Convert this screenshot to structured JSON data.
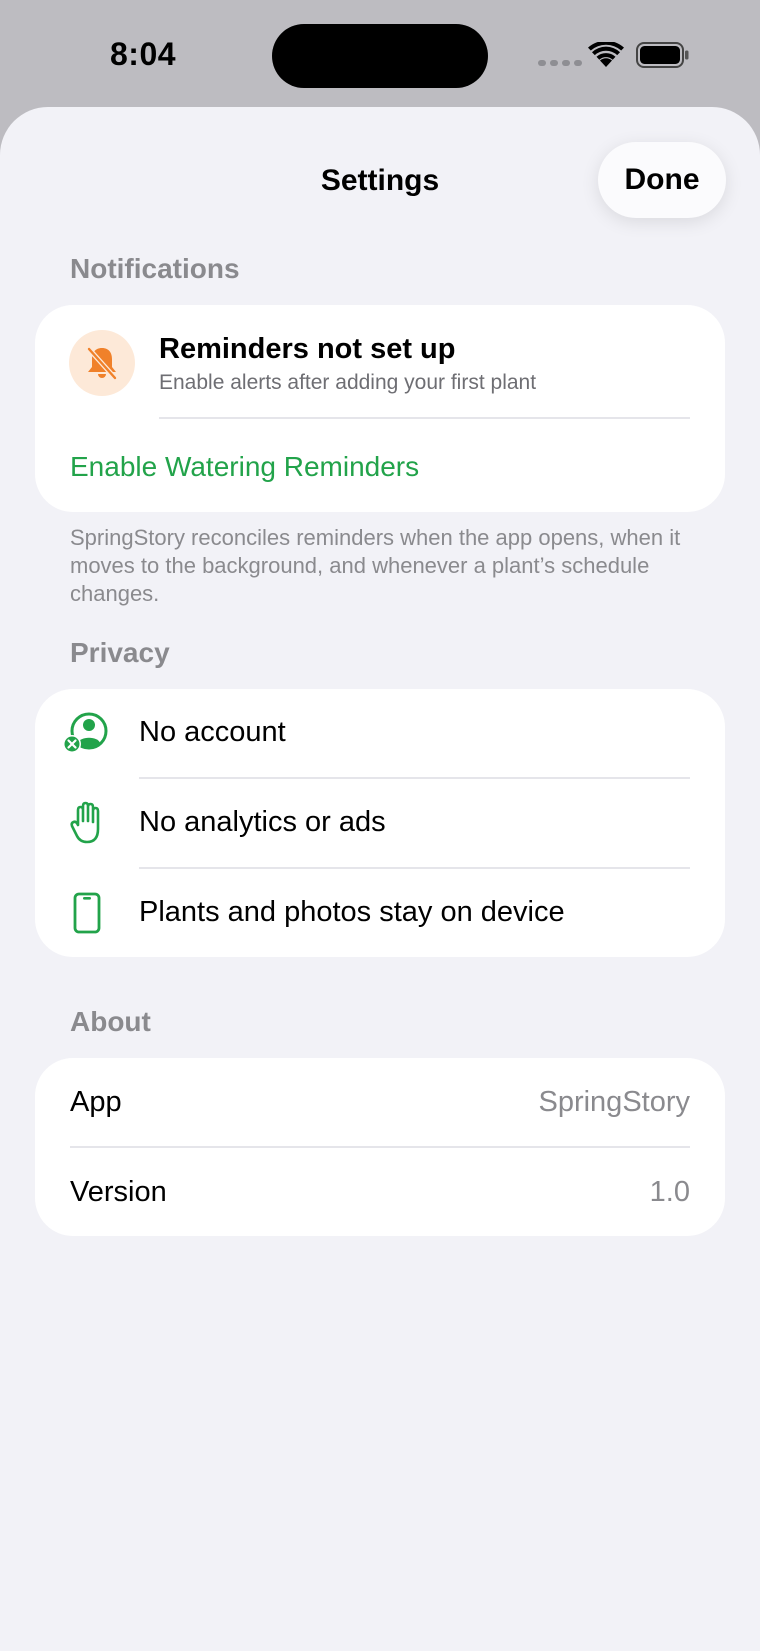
{
  "status_bar": {
    "time": "8:04",
    "icons": [
      "cellular-signal-icon",
      "wifi-icon",
      "battery-icon"
    ]
  },
  "sheet": {
    "title": "Settings",
    "done_label": "Done"
  },
  "notifications": {
    "header": "Notifications",
    "icon": "bell-slash-icon",
    "title": "Reminders not set up",
    "subtitle": "Enable alerts after adding your first plant",
    "action_label": "Enable Watering Reminders",
    "footnote": "SpringStory reconciles reminders when the app opens, when it moves to the background, and whenever a plant’s schedule changes."
  },
  "privacy": {
    "header": "Privacy",
    "items": [
      {
        "label": "No account",
        "icon": "person-crossed-icon"
      },
      {
        "label": "No analytics or ads",
        "icon": "raised-hand-icon"
      },
      {
        "label": "Plants and photos stay on device",
        "icon": "phone-icon"
      }
    ]
  },
  "about": {
    "header": "About",
    "rows": [
      {
        "label": "App",
        "value": "SpringStory"
      },
      {
        "label": "Version",
        "value": "1.0"
      }
    ]
  },
  "colors": {
    "accent_green": "#22a34a",
    "bell_orange": "#f0812a",
    "bell_background": "#fde9d8",
    "secondary_text": "#8a8a8e",
    "sheet_background": "#f2f2f7"
  }
}
